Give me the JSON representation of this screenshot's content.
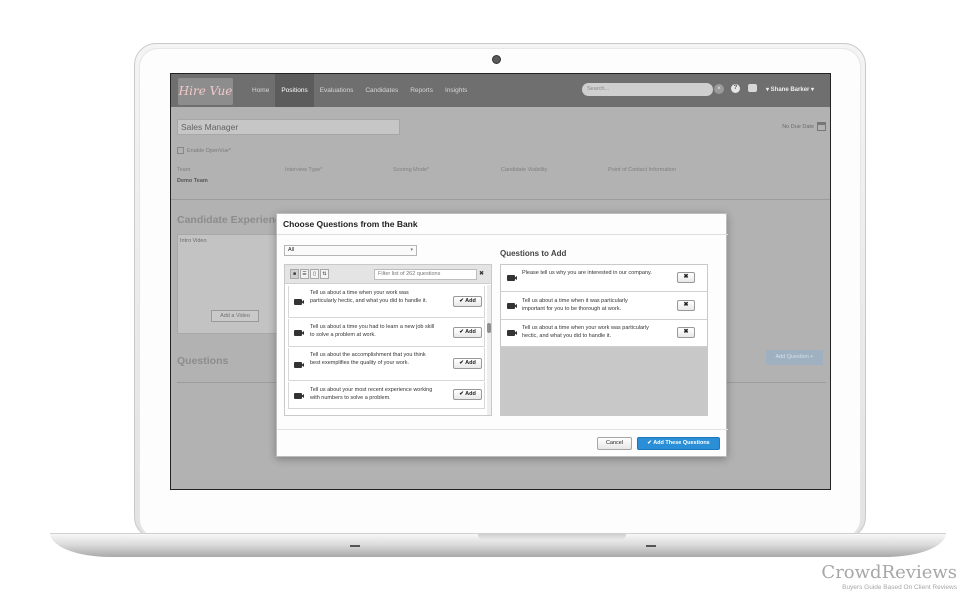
{
  "app": {
    "logo": "Hire Vue",
    "nav": [
      "Home",
      "Positions",
      "Evaluations",
      "Candidates",
      "Reports",
      "Insights"
    ],
    "active_nav": "Positions",
    "search_placeholder": "Search...",
    "user": "▾ Shane Barker ▾"
  },
  "position": {
    "title": "Sales Manager",
    "due_date": "No Due Date",
    "enable_openvue": "Enable OpenVue*",
    "fields": {
      "team_label": "Team",
      "team_value": "Demo Team",
      "interview_type": "Interview Type*",
      "scoring_mode": "Scoring Mode*",
      "candidate_visibility": "Candidate Visibility",
      "point_of_contact": "Point of Contact Information"
    },
    "candidate_experience": "Candidate Experienc",
    "intro_video": "Intro Video",
    "add_video": "Add a Video",
    "questions_heading": "Questions",
    "add_question": "Add Question +"
  },
  "modal": {
    "title": "Choose Questions from the Bank",
    "filter_value": "All",
    "bank_filter_placeholder": "Filter list of 262 questions",
    "add_label": "✔ Add",
    "bank_questions": [
      "Tell us about a time when your work was particularly hectic, and what you did to handle it.",
      "Tell us about a time you had to learn a new job skill to solve a problem at work.",
      "Tell us about the accomplishment that you think best exemplifies the quality of your work.",
      "Tell us about your most recent experience working with numbers to solve a problem."
    ],
    "questions_to_add_title": "Questions to Add",
    "questions_to_add": [
      "Please tell us why you are interested in our company.",
      "Tell us about a time when it was particularly important for you to be thorough at work.",
      "Tell us about a time when your work was particularly hectic, and what you did to handle it."
    ],
    "remove_label": "✖",
    "cancel": "Cancel",
    "confirm": "✔ Add These Questions"
  },
  "watermark": {
    "brand": "CrowdReviews",
    "tagline": "Buyers Guide Based On Client Reviews"
  }
}
